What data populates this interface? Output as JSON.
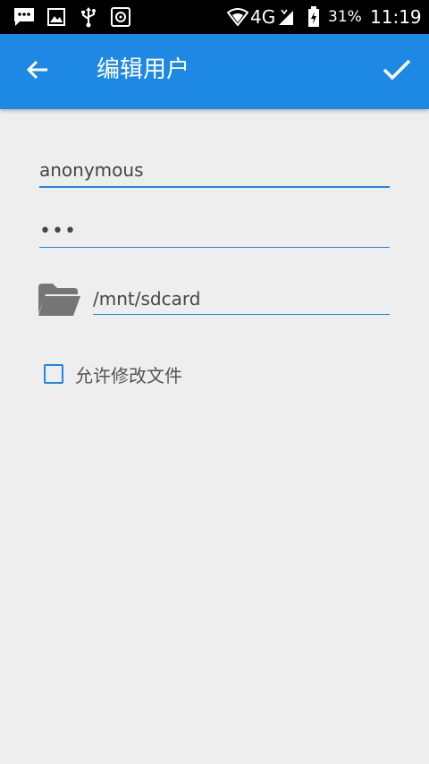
{
  "status_bar": {
    "notification_icons": [
      "message-icon",
      "image-icon",
      "usb-icon",
      "settings-app-icon"
    ],
    "network": "4G",
    "battery": "31%",
    "time": "11:19"
  },
  "app_bar": {
    "title": "编辑用户",
    "back_icon": "arrow-left-icon",
    "confirm_icon": "check-icon",
    "color": "#1e88e5"
  },
  "form": {
    "username": "anonymous",
    "password": "•••",
    "folder_icon": "folder-icon",
    "path": "/mnt/sdcard",
    "allow_modify_label": "允许修改文件",
    "allow_modify_checked": false
  }
}
